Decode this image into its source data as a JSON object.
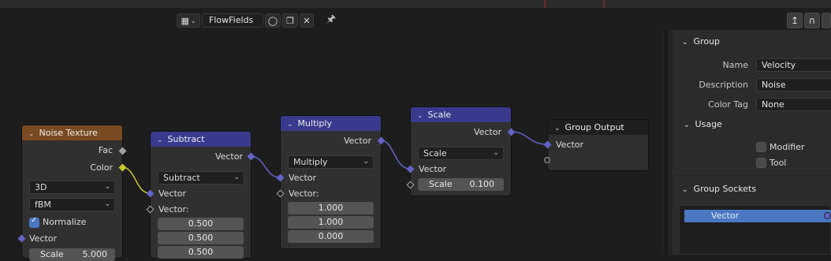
{
  "header": {
    "tree_name": "FlowFields"
  },
  "nodes": {
    "noise": {
      "title": "Noise Texture",
      "out_fac": "Fac",
      "out_color": "Color",
      "dimensions": "3D",
      "noise_type": "fBM",
      "normalize": "Normalize",
      "in_vector": "Vector",
      "scale_label": "Scale",
      "scale_value": "5.000"
    },
    "subtract": {
      "title": "Subtract",
      "out_vector": "Vector",
      "operation": "Subtract",
      "in_vector_a": "Vector",
      "in_vector_b": "Vector:",
      "values": [
        "0.500",
        "0.500",
        "0.500"
      ]
    },
    "multiply": {
      "title": "Multiply",
      "out_vector": "Vector",
      "operation": "Multiply",
      "in_vector_a": "Vector",
      "in_vector_b": "Vector:",
      "values": [
        "1.000",
        "1.000",
        "0.000"
      ]
    },
    "scale": {
      "title": "Scale",
      "out_vector": "Vector",
      "operation": "Scale",
      "in_vector": "Vector",
      "scale_label": "Scale",
      "scale_value": "0.100"
    },
    "group_output": {
      "title": "Group Output",
      "in_vector": "Vector"
    }
  },
  "panel": {
    "group_title": "Group",
    "name_label": "Name",
    "name_value": "Velocity",
    "description_label": "Description",
    "description_value": "Noise",
    "color_tag_label": "Color Tag",
    "color_tag_value": "None",
    "usage_title": "Usage",
    "modifier_label": "Modifier",
    "tool_label": "Tool",
    "sockets_title": "Group Sockets",
    "socket_item": "Vector"
  },
  "colors": {
    "vector_socket": "#6363c7",
    "color_socket": "#c7c729",
    "texture_header": "#7a4a22",
    "vector_header": "#393a8e",
    "selection": "#4a77c2"
  }
}
